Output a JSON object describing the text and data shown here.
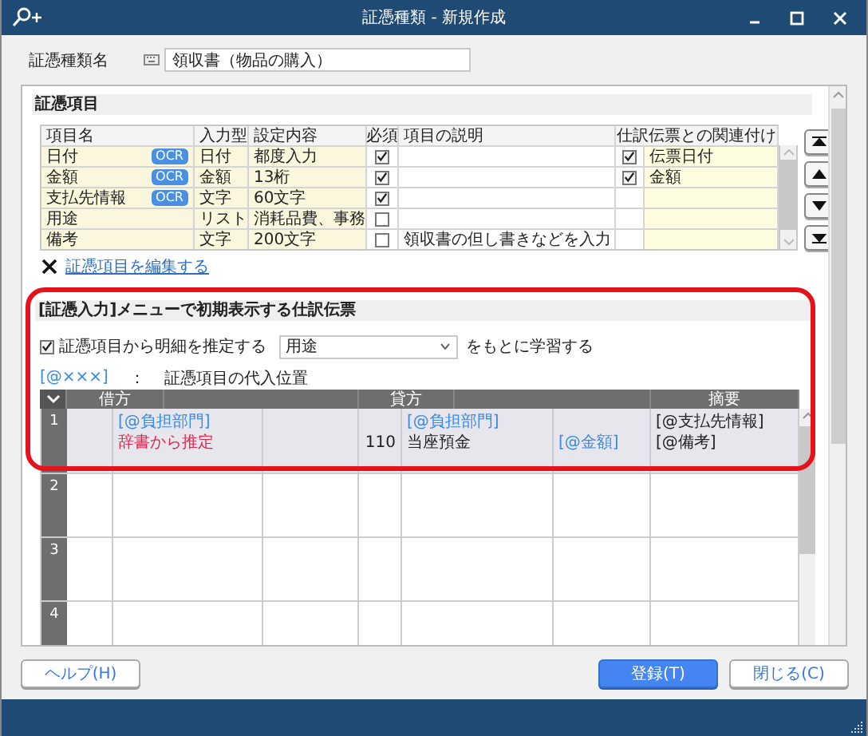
{
  "window": {
    "title": "証憑種類 - 新規作成"
  },
  "voucher_name": {
    "label": "証憑種類名",
    "value": "領収書（物品の購入）"
  },
  "items_section": {
    "title": "証憑項目",
    "columns": [
      "項目名",
      "入力型",
      "設定内容",
      "必須",
      "項目の説明",
      "仕訳伝票との関連付け"
    ],
    "rows": [
      {
        "name": "日付",
        "ocr": "OCR",
        "input_type": "日付",
        "setting": "都度入力",
        "required": true,
        "linked": true,
        "link_field": "伝票日付"
      },
      {
        "name": "金額",
        "ocr": "OCR",
        "input_type": "金額",
        "setting": "13桁",
        "required": true,
        "linked": true,
        "link_field": "金額"
      },
      {
        "name": "支払先情報",
        "ocr": "OCR",
        "input_type": "文字",
        "setting": "60文字",
        "required": true,
        "linked": false
      },
      {
        "name": "用途",
        "input_type": "リスト",
        "setting": "消耗品費、事務",
        "required": false,
        "linked": false
      },
      {
        "name": "備考",
        "input_type": "文字",
        "setting": "200文字",
        "required": false,
        "description": "領収書の但し書きなどを入力",
        "linked": false
      }
    ],
    "edit_link": "証憑項目を編集する"
  },
  "journal_section": {
    "title": "[証憑入力]メニューで初期表示する仕訳伝票",
    "estimate": {
      "label": "証憑項目から明細を推定する",
      "checked": true
    },
    "select": {
      "value": "用途"
    },
    "learn_suffix": "をもとに学習する",
    "legend": {
      "token": "[@×××]",
      "colon": "：",
      "text": "証憑項目の代入位置"
    },
    "columns": [
      "借方",
      "貸方",
      "摘要"
    ],
    "rows": [
      {
        "number": "1",
        "selected": true,
        "cells": [
          {
            "kind": "blank"
          },
          {
            "kind": "text",
            "lines": [
              {
                "text": "[@負担部門]",
                "kind": "field"
              },
              {
                "text": "辞書から推定",
                "kind": "estimate"
              }
            ]
          },
          {
            "kind": "blank"
          },
          {
            "kind": "number",
            "lines": [
              {
                "kind": "gap"
              },
              {
                "text": "110",
                "kind": "plain"
              }
            ]
          },
          {
            "kind": "text",
            "lines": [
              {
                "text": "[@負担部門]",
                "kind": "field"
              },
              {
                "text": "当座預金",
                "kind": "plain"
              }
            ]
          },
          {
            "kind": "text",
            "lines": [
              {
                "kind": "gap"
              },
              {
                "text": "[@金額]",
                "kind": "field"
              }
            ]
          },
          {
            "kind": "text",
            "lines": [
              {
                "text": "[@支払先情報]",
                "kind": "plain"
              },
              {
                "text": "[@備考]",
                "kind": "plain"
              }
            ]
          }
        ]
      },
      {
        "number": "2",
        "selected": false
      },
      {
        "number": "3",
        "selected": false
      },
      {
        "number": "4",
        "selected": false
      }
    ]
  },
  "buttons": [
    {
      "label": "ヘルプ(H)",
      "kind": "help"
    },
    {
      "label": "登録(T)",
      "kind": "primary"
    },
    {
      "label": "閉じる(C)",
      "kind": "secondary"
    }
  ]
}
